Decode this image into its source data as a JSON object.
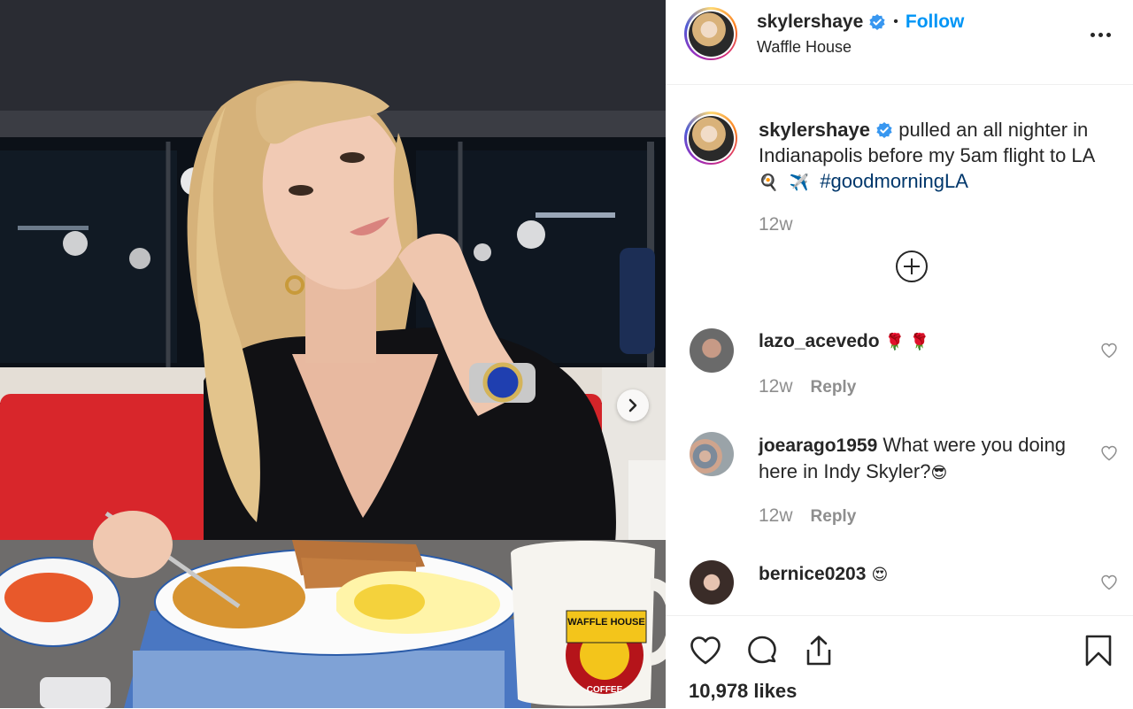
{
  "post": {
    "author": "skylershaye",
    "follow_label": "Follow",
    "dot": "•",
    "location": "Waffle House",
    "caption_pre": "pulled an all nighter in Indianapolis before my 5am flight to LA",
    "caption_emoji_1": "🍳",
    "caption_emoji_2": "✈️",
    "hashtag": "#goodmorningLA",
    "time": "12w",
    "likes": "10,978 likes"
  },
  "photo": {
    "mug_brand_top": "WAFFLE HOUSE",
    "mug_brand_bottom": "COFFEE"
  },
  "comments": [
    {
      "username": "lazo_acevedo",
      "text": "",
      "emoji": "🌹 🌹",
      "time": "12w",
      "reply_label": "Reply"
    },
    {
      "username": "joearago1959",
      "text": "What were you doing here in Indy Skyler?",
      "emoji": "😎",
      "time": "12w",
      "reply_label": "Reply"
    },
    {
      "username": "bernice0203",
      "text": "",
      "emoji": "😍"
    }
  ],
  "colors": {
    "link_blue": "#0095f6",
    "hashtag_blue": "#00376b",
    "meta_gray": "#8e8e8e",
    "verified_blue": "#3897f0"
  },
  "icons": [
    "verified-badge-icon",
    "more-options-icon",
    "load-more-comments-icon",
    "heart-icon",
    "comment-icon",
    "share-icon",
    "bookmark-icon",
    "next-image-icon"
  ]
}
